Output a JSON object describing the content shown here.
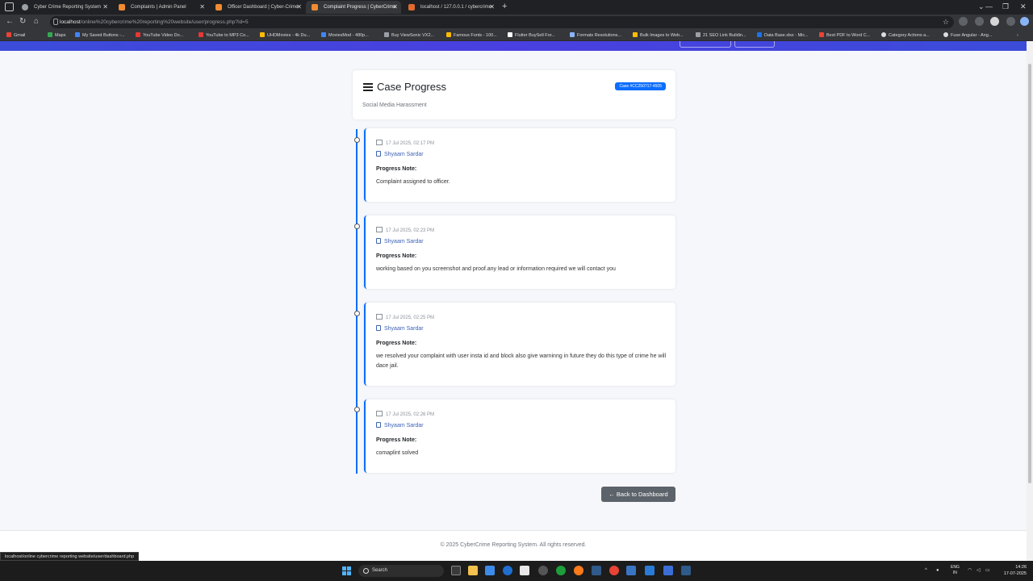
{
  "browser": {
    "tabs": [
      {
        "label": "Cyber Crime Reporting System",
        "active": false,
        "color": "#9aa0a6"
      },
      {
        "label": "Complaints | Admin Panel",
        "active": false,
        "color": "#f28b30"
      },
      {
        "label": "Officer Dashboard | Cyber-Crime",
        "active": false,
        "color": "#f28b30"
      },
      {
        "label": "Complaint Progress | CyberCrime",
        "active": true,
        "color": "#f28b30"
      },
      {
        "label": "localhost / 127.0.0.1 / cybercrime",
        "active": false,
        "color": "#e06b2f"
      }
    ],
    "url_host": "localhost",
    "url_path": "/online%20cybercrime%20reporting%20website/user/progress.php?id=5",
    "bookmarks": [
      "Gmail",
      "Maps",
      "My Saved Buttons -...",
      "YouTube Video Do...",
      "YouTube to MP3 Co...",
      "UHDMovies - 4k Du...",
      "MoviesMod - 480p...",
      "Buy ViewSonic VX2...",
      "Famous Fonts - 100...",
      "Flutter BuySell For...",
      "Formats Resolutions...",
      "Bulk Images to Web...",
      "21 SEO Link Buildin...",
      "Data Base.xlsx - Mic...",
      "Best PDF to Word C...",
      "Category Actions a...",
      "Fuse Angular - Ang..."
    ],
    "status_url": "localhost/online cybercrime reporting website/user/dashboard.php"
  },
  "case": {
    "title": "Case Progress",
    "badge": "Case #CC250717-4505",
    "category": "Social Media Harassment"
  },
  "progress": [
    {
      "date": "17 Jul 2025, 02:17 PM",
      "officer": "Shyaam Sardar",
      "label": "Progress Note:",
      "note": "Complaint assigned to officer."
    },
    {
      "date": "17 Jul 2025, 02:23 PM",
      "officer": "Shyaam Sardar",
      "label": "Progress Note:",
      "note": "working based on you screenshot and proof.any lead or information required we will contact you"
    },
    {
      "date": "17 Jul 2025, 02:25 PM",
      "officer": "Shyaam Sardar",
      "label": "Progress Note:",
      "note": "we resolved your complaint with user insta id and block also give warninng in future they do this type of crime he will dace jail."
    },
    {
      "date": "17 Jul 2025, 02:26 PM",
      "officer": "Shyaam Sardar",
      "label": "Progress Note:",
      "note": "comaplint solved"
    }
  ],
  "back_button": "← Back to Dashboard",
  "footer": "© 2025 CyberCrime Reporting System. All rights reserved.",
  "taskbar": {
    "search": "Search",
    "lang_top": "ENG",
    "lang_bottom": "IN",
    "time": "14:26",
    "date": "17-07-2025"
  },
  "colors": {
    "primary": "#0d6efd",
    "navbar": "#3b4cd9",
    "secondary": "#5c636a"
  }
}
